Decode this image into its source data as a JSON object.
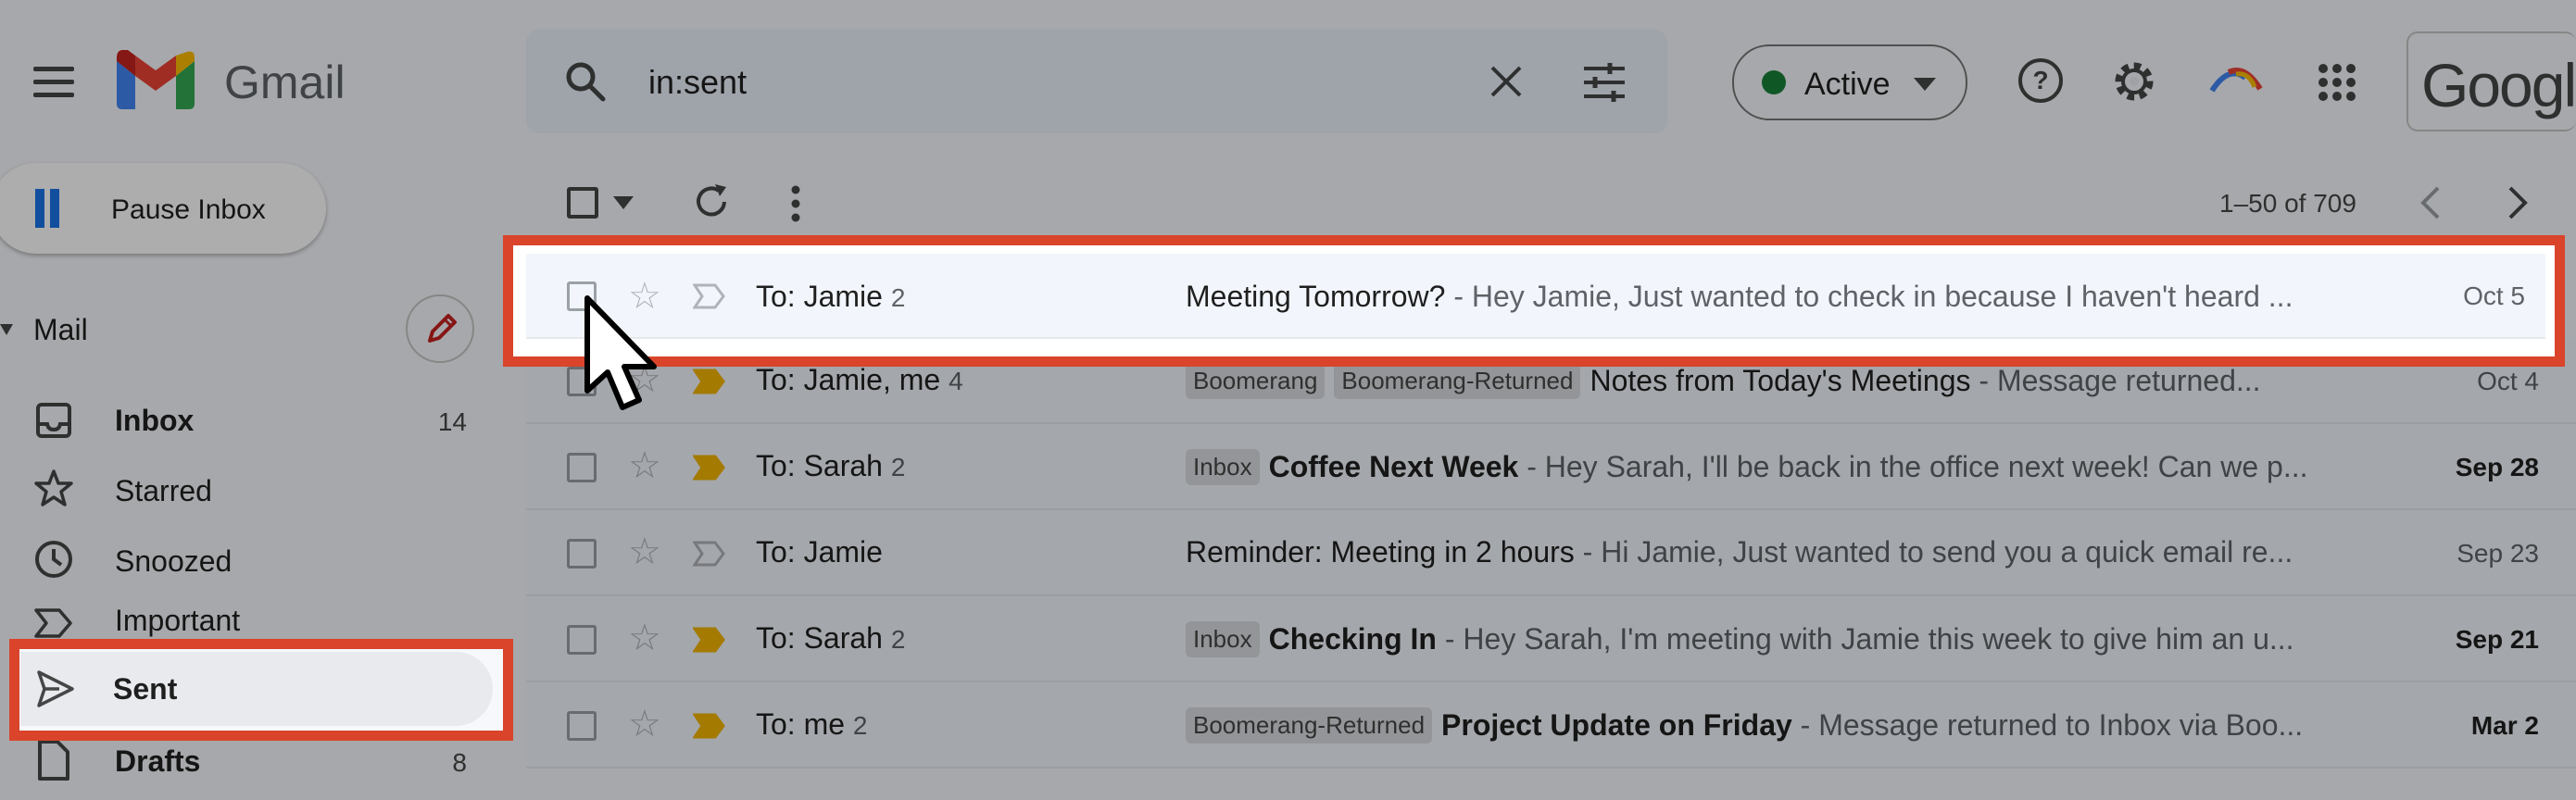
{
  "header": {
    "app_name": "Gmail",
    "search_value": "in:sent",
    "status_label": "Active",
    "google_label": "Google"
  },
  "sidebar": {
    "pause_label": "Pause Inbox",
    "mail_label": "Mail",
    "items": [
      {
        "label": "Inbox",
        "count": "14",
        "icon": "inbox-icon",
        "bold": true
      },
      {
        "label": "Starred",
        "count": "",
        "icon": "star-icon",
        "bold": false
      },
      {
        "label": "Snoozed",
        "count": "",
        "icon": "clock-icon",
        "bold": false
      },
      {
        "label": "Important",
        "count": "",
        "icon": "important-icon",
        "bold": false
      },
      {
        "label": "Sent",
        "count": "",
        "icon": "send-icon",
        "bold": true
      },
      {
        "label": "Drafts",
        "count": "8",
        "icon": "draft-icon",
        "bold": true
      }
    ]
  },
  "toolbar": {
    "pager_text": "1–50 of 709"
  },
  "emails": [
    {
      "to": "To: Jamie",
      "count": "2",
      "chips": [],
      "subject": "Meeting Tomorrow?",
      "snippet": " - Hey Jamie, Just wanted to check in because I haven't heard ...",
      "date": "Oct 5",
      "bold": false,
      "important": false
    },
    {
      "to": "To: Jamie, me",
      "count": "4",
      "chips": [
        "Boomerang",
        "Boomerang-Returned"
      ],
      "subject": "Notes from Today's Meetings",
      "snippet": " - Message returned...",
      "date": "Oct 4",
      "bold": false,
      "important": true
    },
    {
      "to": "To: Sarah",
      "count": "2",
      "chips": [
        "Inbox"
      ],
      "subject": "Coffee Next Week",
      "snippet": " - Hey Sarah, I'll be back in the office next week! Can we p...",
      "date": "Sep 28",
      "bold": true,
      "important": true
    },
    {
      "to": "To: Jamie",
      "count": "",
      "chips": [],
      "subject": "Reminder: Meeting in 2 hours",
      "snippet": " - Hi Jamie, Just wanted to send you a quick email re...",
      "date": "Sep 23",
      "bold": false,
      "important": false
    },
    {
      "to": "To: Sarah",
      "count": "2",
      "chips": [
        "Inbox"
      ],
      "subject": "Checking In",
      "snippet": " - Hey Sarah, I'm meeting with Jamie this week to give him an u...",
      "date": "Sep 21",
      "bold": true,
      "important": true
    },
    {
      "to": "To: me",
      "count": "2",
      "chips": [
        "Boomerang-Returned"
      ],
      "subject": "Project Update on Friday",
      "snippet": " - Message returned to Inbox via Boo...",
      "date": "Mar 2",
      "bold": true,
      "important": true
    }
  ],
  "colors": {
    "highlight_border": "#d9442b",
    "important_marker": "#f2b400",
    "active_dot": "#188038"
  }
}
